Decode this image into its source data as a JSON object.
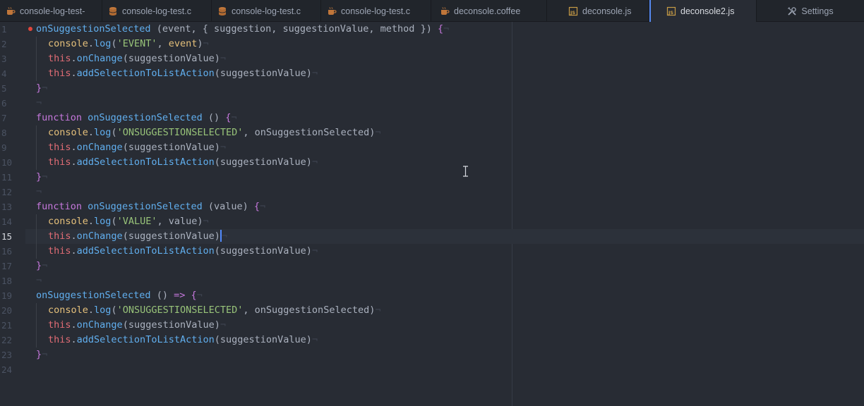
{
  "tabs": [
    {
      "title": "console-log-test-",
      "icon": "coffee-icon",
      "active": false
    },
    {
      "title": "console-log-test.c",
      "icon": "database-icon",
      "active": false
    },
    {
      "title": "console-log-test.c",
      "icon": "database-icon",
      "active": false
    },
    {
      "title": "console-log-test.c",
      "icon": "coffee-icon",
      "active": false
    },
    {
      "title": "deconsole.coffee",
      "icon": "coffee-icon",
      "active": false
    },
    {
      "title": "deconsole.js",
      "icon": "js-file-icon",
      "active": false
    },
    {
      "title": "deconsole2.js",
      "icon": "js-file-icon",
      "active": true
    },
    {
      "title": "Settings",
      "icon": "tools-icon",
      "active": false
    }
  ],
  "editor": {
    "current_line": 15,
    "line_numbers": [
      "1",
      "2",
      "3",
      "4",
      "5",
      "6",
      "7",
      "8",
      "9",
      "10",
      "11",
      "12",
      "13",
      "14",
      "15",
      "16",
      "17",
      "18",
      "19",
      "20",
      "21",
      "22",
      "23",
      "24"
    ],
    "invisible_eol": "¬",
    "tokens": {
      "fn_name": "onSuggestionSelected",
      "function_kw": "function",
      "console": "console",
      "log": "log",
      "this": "this",
      "onChange": "onChange",
      "addSelection": "addSelectionToListAction",
      "arg_suggestionValue": "suggestionValue",
      "params_1": " (event, { suggestion, suggestionValue, method }) ",
      "params_empty": " () ",
      "params_value": " (value) ",
      "arrow": "=>",
      "str_event": "'EVENT'",
      "str_onsug": "'ONSUGGESTIONSELECTED'",
      "str_value": "'VALUE'",
      "arg_event": "event",
      "arg_value": "value",
      "arg_onsug": "onSuggestionSelected"
    }
  },
  "colors": {
    "accent": "#568af2",
    "keyword": "#c678dd",
    "function": "#61afef",
    "string": "#98c379",
    "this": "#e06c75",
    "object": "#e5c07b",
    "modified_dot": "#e0463c"
  }
}
